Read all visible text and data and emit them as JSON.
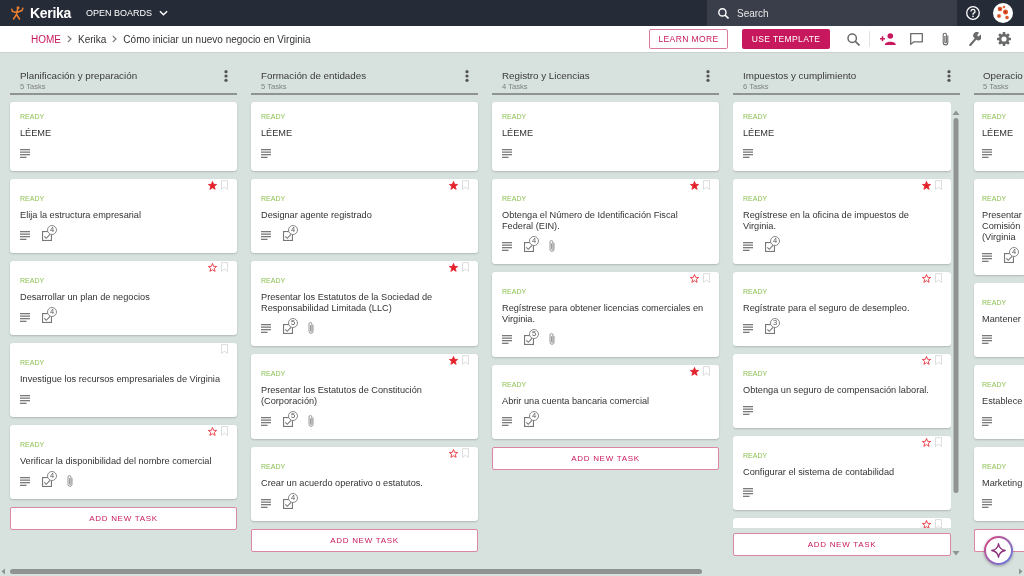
{
  "app_bar": {
    "logo": "Kerika",
    "boards_menu": "OPEN BOARDS",
    "search": {
      "placeholder": "Search"
    }
  },
  "breadcrumb": [
    {
      "label": "HOME",
      "kind": "link"
    },
    {
      "label": "Kerika",
      "kind": "text"
    },
    {
      "label": "Cómo iniciar un nuevo negocio en Virginia",
      "kind": "text"
    }
  ],
  "actions": [
    {
      "label": "LEARN MORE",
      "kind": "outlined"
    },
    {
      "label": "USE TEMPLATE",
      "kind": "filled"
    }
  ],
  "columns": [
    {
      "title": "Planificación y preparación",
      "count": "5 Tasks",
      "scrollbar": false,
      "cut_off": false,
      "add_task_button": true,
      "add_task_label": "ADD NEW TASK",
      "cards": [
        {
          "kind": "readme",
          "status": "READY",
          "title": "LÉEME",
          "badges": [
            {
              "kind": "notes"
            }
          ]
        },
        {
          "kind": "task",
          "starred": true,
          "bookmarked": false,
          "status": "READY",
          "title": "Elija la estructura empresarial",
          "badges": [
            {
              "kind": "notes"
            },
            {
              "kind": "checklist",
              "count": "4"
            }
          ]
        },
        {
          "kind": "task",
          "starred": false,
          "bookmarked": false,
          "status": "READY",
          "title": "Desarrollar un plan de negocios",
          "badges": [
            {
              "kind": "notes"
            },
            {
              "kind": "checklist",
              "count": "4"
            }
          ]
        },
        {
          "kind": "task",
          "bookmarked": false,
          "status": "READY",
          "title": "Investigue los recursos empresariales de Virginia",
          "badges": [
            {
              "kind": "notes"
            }
          ]
        },
        {
          "kind": "task",
          "starred": false,
          "bookmarked": false,
          "status": "READY",
          "title": "Verificar la disponibilidad del nombre comercial",
          "badges": [
            {
              "kind": "notes"
            },
            {
              "kind": "checklist",
              "count": "4"
            },
            {
              "kind": "attachment"
            }
          ]
        }
      ]
    },
    {
      "title": "Formación de entidades",
      "count": "5 Tasks",
      "scrollbar": false,
      "cut_off": false,
      "add_task_button": true,
      "add_task_label": "ADD NEW TASK",
      "cards": [
        {
          "kind": "readme",
          "status": "READY",
          "title": "LÉEME",
          "badges": [
            {
              "kind": "notes"
            }
          ]
        },
        {
          "kind": "task",
          "starred": true,
          "bookmarked": false,
          "status": "READY",
          "title": "Designar agente registrado",
          "badges": [
            {
              "kind": "notes"
            },
            {
              "kind": "checklist",
              "count": "4"
            }
          ]
        },
        {
          "kind": "task",
          "starred": true,
          "bookmarked": false,
          "status": "READY",
          "title": "Presentar los Estatutos de la Sociedad de Responsabilidad Limitada (LLC)",
          "badges": [
            {
              "kind": "notes"
            },
            {
              "kind": "checklist",
              "count": "5"
            },
            {
              "kind": "attachment"
            }
          ]
        },
        {
          "kind": "task",
          "starred": true,
          "bookmarked": false,
          "status": "READY",
          "title": "Presentar los Estatutos de Constitución (Corporación)",
          "badges": [
            {
              "kind": "notes"
            },
            {
              "kind": "checklist",
              "count": "5"
            },
            {
              "kind": "attachment"
            }
          ]
        },
        {
          "kind": "task",
          "starred": false,
          "bookmarked": false,
          "status": "READY",
          "title": "Crear un acuerdo operativo o estatutos.",
          "badges": [
            {
              "kind": "notes"
            },
            {
              "kind": "checklist",
              "count": "4"
            }
          ]
        }
      ]
    },
    {
      "title": "Registro y Licencias",
      "count": "4 Tasks",
      "scrollbar": false,
      "cut_off": false,
      "add_task_button": true,
      "add_task_label": "ADD NEW TASK",
      "cards": [
        {
          "kind": "readme",
          "status": "READY",
          "title": "LÉEME",
          "badges": [
            {
              "kind": "notes"
            }
          ]
        },
        {
          "kind": "task",
          "starred": true,
          "bookmarked": false,
          "status": "READY",
          "title": "Obtenga el Número de Identificación Fiscal Federal (EIN).",
          "badges": [
            {
              "kind": "notes"
            },
            {
              "kind": "checklist",
              "count": "4"
            },
            {
              "kind": "attachment"
            }
          ]
        },
        {
          "kind": "task",
          "starred": false,
          "bookmarked": false,
          "status": "READY",
          "title": "Regístrese para obtener licencias comerciales en Virginia.",
          "badges": [
            {
              "kind": "notes"
            },
            {
              "kind": "checklist",
              "count": "5"
            },
            {
              "kind": "attachment"
            }
          ]
        },
        {
          "kind": "task",
          "starred": true,
          "bookmarked": false,
          "status": "READY",
          "title": "Abrir una cuenta bancaria comercial",
          "badges": [
            {
              "kind": "notes"
            },
            {
              "kind": "checklist",
              "count": "4"
            }
          ]
        }
      ]
    },
    {
      "title": "Impuestos y cumplimiento",
      "count": "6 Tasks",
      "scrollbar": true,
      "cut_off": false,
      "add_task_button": true,
      "add_task_label": "ADD NEW TASK",
      "cards": [
        {
          "kind": "readme",
          "status": "READY",
          "title": "LÉEME",
          "badges": [
            {
              "kind": "notes"
            }
          ]
        },
        {
          "kind": "task",
          "starred": true,
          "bookmarked": false,
          "status": "READY",
          "title": "Regístrese en la oficina de impuestos de Virginia.",
          "badges": [
            {
              "kind": "notes"
            },
            {
              "kind": "checklist",
              "count": "4"
            }
          ]
        },
        {
          "kind": "task",
          "starred": false,
          "bookmarked": false,
          "status": "READY",
          "title": "Regístrate para el seguro de desempleo.",
          "badges": [
            {
              "kind": "notes"
            },
            {
              "kind": "checklist",
              "count": "3"
            }
          ]
        },
        {
          "kind": "task",
          "starred": false,
          "bookmarked": false,
          "status": "READY",
          "title": "Obtenga un seguro de compensación laboral.",
          "badges": [
            {
              "kind": "notes"
            }
          ]
        },
        {
          "kind": "task",
          "starred": false,
          "bookmarked": false,
          "status": "READY",
          "title": "Configurar el sistema de contabilidad",
          "badges": [
            {
              "kind": "notes"
            }
          ]
        },
        {
          "kind": "task",
          "starred": false,
          "bookmarked": false
        }
      ]
    },
    {
      "title": "Operacio",
      "count": "5 Tasks",
      "scrollbar": false,
      "cut_off": true,
      "add_task_button": true,
      "cards": [
        {
          "kind": "readme",
          "status": "READY",
          "title": "LÉEME",
          "badges": [
            {
              "kind": "notes"
            }
          ]
        },
        {
          "kind": "task",
          "status": "READY",
          "title": "Presentar Comisión (Virginia",
          "badges": [
            {
              "kind": "notes"
            },
            {
              "kind": "checklist",
              "count": "4"
            }
          ]
        },
        {
          "kind": "task",
          "status": "READY",
          "title": "Mantener",
          "badges": [
            {
              "kind": "notes"
            }
          ]
        },
        {
          "kind": "task",
          "status": "READY",
          "title": "Establece",
          "badges": [
            {
              "kind": "notes"
            }
          ]
        },
        {
          "kind": "task",
          "status": "READY",
          "title": "Marketing",
          "badges": [
            {
              "kind": "notes"
            }
          ]
        }
      ]
    }
  ]
}
